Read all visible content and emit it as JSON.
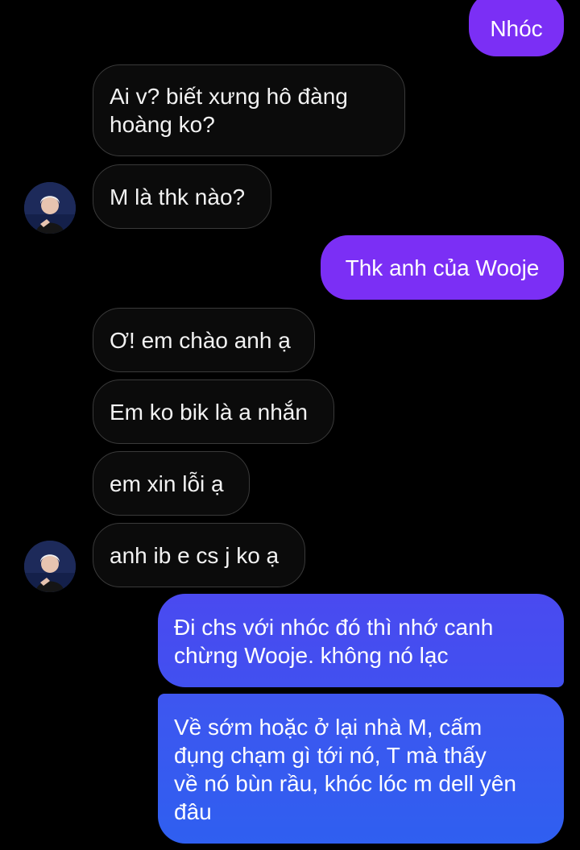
{
  "conversation": {
    "messages": [
      {
        "sender": "me",
        "text": "Nhóc"
      },
      {
        "sender": "contact",
        "text": "Ai v? biết xưng hô đàng\nhoàng ko?"
      },
      {
        "sender": "contact",
        "text": "M là thk nào?"
      },
      {
        "sender": "me",
        "text": "Thk anh của Wooje"
      },
      {
        "sender": "contact",
        "text": "Ơ! em chào anh ạ"
      },
      {
        "sender": "contact",
        "text": "Em ko bik là a nhắn"
      },
      {
        "sender": "contact",
        "text": "em xin lỗi ạ"
      },
      {
        "sender": "contact",
        "text": "anh ib e cs j ko ạ"
      },
      {
        "sender": "me",
        "text": "Đi chs với nhóc đó thì nhớ canh\nchừng Wooje. không nó lạc"
      },
      {
        "sender": "me",
        "text": "Về sớm hoặc ở lại nhà M, cấm\nđụng chạm gì tới nó, T mà thấy\nvề nó bùn rầu, khóc lóc m dell yên\nđâu"
      }
    ],
    "avatar_icon": "contact-avatar-icon"
  },
  "colors": {
    "background": "#000000",
    "incoming_bubble": "#0b0b0b",
    "incoming_border": "#3a3a3a",
    "outgoing_purple": "#7b2ff5",
    "outgoing_blue_start": "#4a4af0",
    "outgoing_blue_end": "#2f5ff0"
  }
}
